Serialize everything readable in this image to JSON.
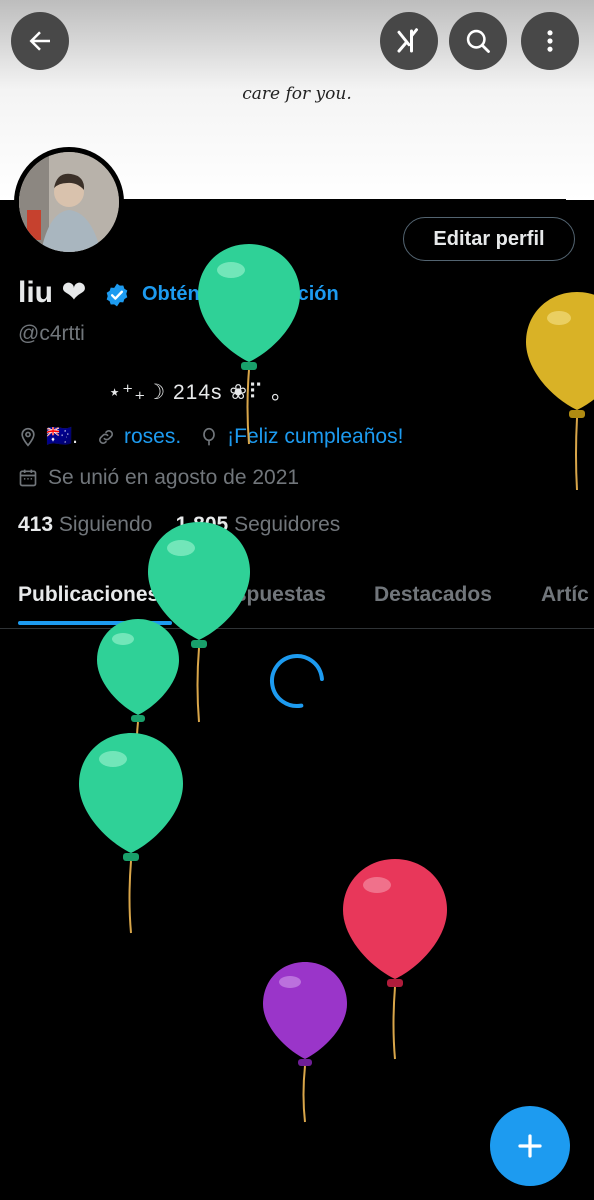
{
  "banner": {
    "text": "care for you."
  },
  "topbar": {
    "back_icon": "arrow-left-icon",
    "grok_icon": "grok-icon",
    "search_icon": "search-icon",
    "more_icon": "more-vertical-icon"
  },
  "profile": {
    "edit_button": "Editar perfil",
    "name": "liu ❤",
    "verify_link": "Obtén la verificación",
    "handle": "@c4rtti",
    "bio": "⋆⁺₊☽  214s ❀⠏  。",
    "location": "🇦🇺.",
    "website": "roses.",
    "birthday": "¡Feliz cumpleaños!",
    "joined": "Se unió en agosto de 2021",
    "following_count": "413",
    "following_label": "Siguiendo",
    "followers_count": "1,805",
    "followers_label": "Seguidores"
  },
  "tabs": [
    {
      "label": "Publicaciones",
      "active": true
    },
    {
      "label": "Respuestas",
      "active": false
    },
    {
      "label": "Destacados",
      "active": false
    },
    {
      "label": "Artíc",
      "active": false
    }
  ],
  "fab": {
    "icon": "plus-icon"
  },
  "colors": {
    "accent": "#1d9bf0",
    "muted": "#71767b",
    "text": "#e7e9ea",
    "background": "#000000"
  }
}
